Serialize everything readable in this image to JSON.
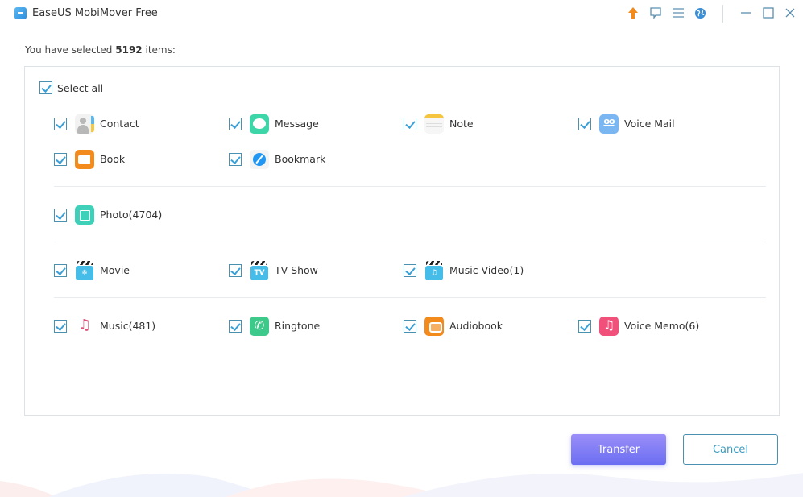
{
  "window": {
    "title": "EaseUS MobiMover Free",
    "controls": {
      "upgrade": "upgrade-arrow-icon",
      "feedback": "feedback-icon",
      "menu": "menu-icon",
      "language": "globe-icon",
      "minimize": "minimize-icon",
      "maximize": "maximize-icon",
      "close": "close-icon"
    }
  },
  "selection": {
    "prefix": "You have selected",
    "count": "5192",
    "suffix": "items:"
  },
  "select_all": {
    "label": "Select all",
    "checked": true
  },
  "groups": [
    {
      "items": [
        {
          "label": "Contact",
          "icon": "contact-icon",
          "checked": true
        },
        {
          "label": "Message",
          "icon": "message-icon",
          "checked": true
        },
        {
          "label": "Note",
          "icon": "note-icon",
          "checked": true
        },
        {
          "label": "Voice Mail",
          "icon": "voicemail-icon",
          "checked": true
        },
        {
          "label": "Book",
          "icon": "book-icon",
          "checked": true
        },
        {
          "label": "Bookmark",
          "icon": "bookmark-icon",
          "checked": true
        }
      ]
    },
    {
      "items": [
        {
          "label": "Photo(4704)",
          "icon": "photo-icon",
          "checked": true
        }
      ]
    },
    {
      "items": [
        {
          "label": "Movie",
          "icon": "movie-icon",
          "checked": true
        },
        {
          "label": "TV Show",
          "icon": "tv-show-icon",
          "checked": true,
          "icon_text": "TV"
        },
        {
          "label": "Music Video(1)",
          "icon": "music-video-icon",
          "checked": true
        }
      ]
    },
    {
      "items": [
        {
          "label": "Music(481)",
          "icon": "music-icon",
          "checked": true
        },
        {
          "label": "Ringtone",
          "icon": "ringtone-icon",
          "checked": true
        },
        {
          "label": "Audiobook",
          "icon": "audiobook-icon",
          "checked": true
        },
        {
          "label": "Voice Memo(6)",
          "icon": "voice-memo-icon",
          "checked": true
        }
      ]
    }
  ],
  "buttons": {
    "transfer": "Transfer",
    "cancel": "Cancel"
  },
  "colors": {
    "accent": "#3aa0d8",
    "transfer_button": "#7b7cf4",
    "cancel_border": "#4a90b0"
  }
}
